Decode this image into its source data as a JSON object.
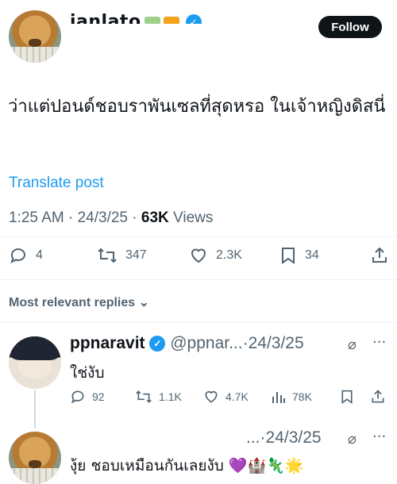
{
  "author": {
    "username": "ianlato",
    "avatar_icon": "dog-avatar-icon"
  },
  "follow_label": "Follow",
  "post": {
    "text": "ว่าแต่ปอนด์ชอบราพันเซลที่สุดหรอ ในเจ้าหญิงดิสนี่",
    "translate_label": "Translate post",
    "time": "1:25 AM",
    "date": "24/3/25",
    "views_count": "63K",
    "views_label": "Views"
  },
  "stats": {
    "replies": "4",
    "reposts": "347",
    "likes": "2.3K",
    "bookmarks": "34"
  },
  "replies_sort_label": "Most relevant replies",
  "replies": [
    {
      "name": "ppnaravit",
      "handle": "@ppnar...",
      "date": "·24/3/25",
      "text": "ใช่งับ",
      "replies": "92",
      "reposts": "1.1K",
      "likes": "4.7K",
      "views": "78K",
      "avatar_icon": "anime-avatar-icon"
    },
    {
      "handle": "...",
      "date": "·24/3/25",
      "text": "งุ้ย ชอบเหมือนกันเลยงับ 💜🏰🦎🌟",
      "avatar_icon": "dog-avatar-icon"
    }
  ],
  "colors": {
    "accent": "#1d9bf0",
    "text": "#0f1419",
    "muted": "#536471",
    "separator": "#eff3f4"
  }
}
